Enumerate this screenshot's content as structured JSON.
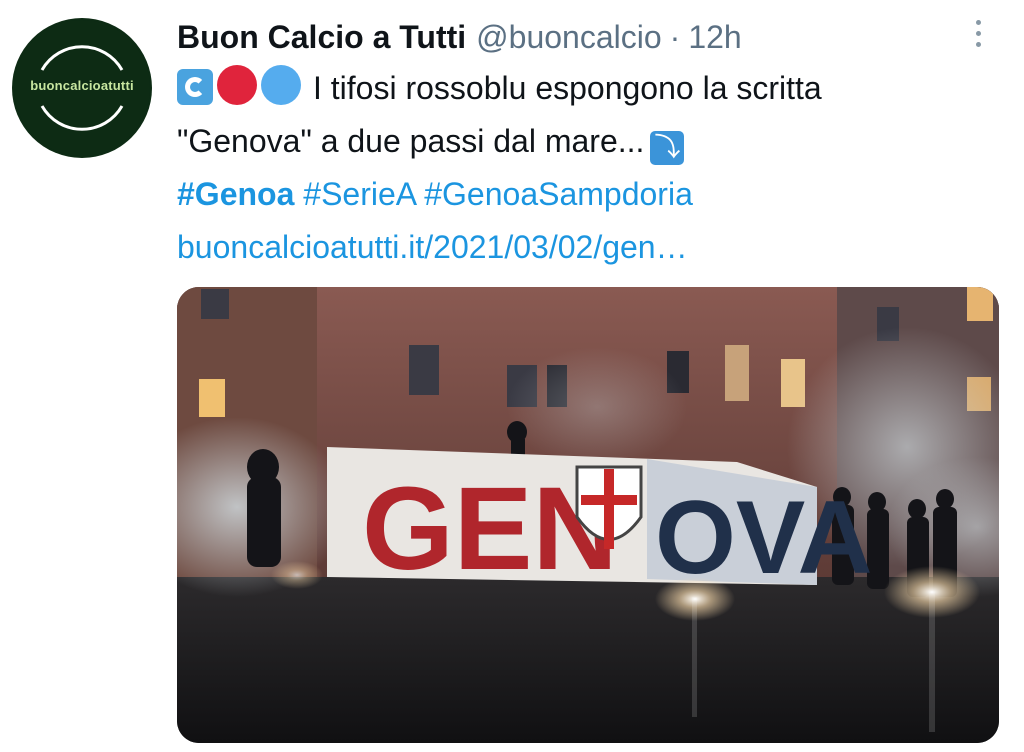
{
  "tweet": {
    "avatar_text": "buoncalcioatutti",
    "display_name": "Buon Calcio a Tutti",
    "handle": "@buoncalcio",
    "separator": "·",
    "time": "12h",
    "text_line1": "I tifosi rossoblu espongono la scritta",
    "text_line2": "\"Genova\" a due passi dal mare...",
    "hashtags": [
      "#Genoa",
      "#SerieA",
      "#GenoaSampdoria"
    ],
    "link": "buoncalcioatutti.it/2021/03/02/gen…",
    "icons": {
      "emoji1": "water-wave-icon",
      "emoji2": "red-circle-icon",
      "emoji3": "blue-circle-icon",
      "emoji4": "arrow-down-right-icon",
      "more": "more-vertical-icon"
    },
    "media": {
      "banner_text_left": "GEN",
      "banner_text_right": "OVA"
    }
  },
  "colors": {
    "link": "#1b95e0",
    "muted": "#5b7083",
    "text": "#0f1419",
    "avatar_bg": "#0d2b14"
  }
}
